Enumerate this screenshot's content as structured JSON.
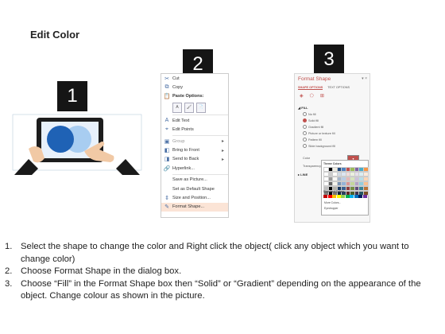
{
  "title": "Edit Color",
  "badges": [
    "1",
    "2",
    "3"
  ],
  "context_menu": {
    "items": [
      {
        "icon": "cut-icon",
        "glyph": "✂",
        "label": "Cut",
        "style": "normal"
      },
      {
        "icon": "copy-icon",
        "glyph": "⧉",
        "label": "Copy",
        "style": "normal"
      },
      {
        "icon": "paste-icon",
        "glyph": "📋",
        "label": "Paste Options:",
        "style": "bold"
      },
      {
        "icon": "edit-text-icon",
        "glyph": "A",
        "label": "Edit Text",
        "style": "normal"
      },
      {
        "icon": "edit-points-icon",
        "glyph": "⌖",
        "label": "Edit Points",
        "style": "normal"
      },
      {
        "icon": "group-icon",
        "glyph": "▣",
        "label": "Group",
        "style": "dim",
        "submenu": true
      },
      {
        "icon": "bring-front-icon",
        "glyph": "◧",
        "label": "Bring to Front",
        "style": "normal",
        "submenu": true
      },
      {
        "icon": "send-back-icon",
        "glyph": "◨",
        "label": "Send to Back",
        "style": "normal",
        "submenu": true
      },
      {
        "icon": "hyperlink-icon",
        "glyph": "🔗",
        "label": "Hyperlink...",
        "style": "normal"
      },
      {
        "icon": "save-picture-icon",
        "glyph": "",
        "label": "Save as Picture...",
        "style": "normal"
      },
      {
        "icon": "default-shape-icon",
        "glyph": "",
        "label": "Set as Default Shape",
        "style": "normal"
      },
      {
        "icon": "size-position-icon",
        "glyph": "⇕",
        "label": "Size and Position...",
        "style": "normal"
      },
      {
        "icon": "format-shape-icon",
        "glyph": "✎",
        "label": "Format Shape...",
        "style": "normal",
        "highlight": true
      }
    ]
  },
  "format_pane": {
    "title": "Format Shape",
    "close": "▾ ×",
    "tabs": [
      "SHAPE OPTIONS",
      "TEXT OPTIONS"
    ],
    "fill_header": "◢ FILL",
    "fill_options": [
      "No fill",
      "Solid fill",
      "Gradient fill",
      "Picture or texture fill",
      "Pattern fill",
      "Slide background fill"
    ],
    "selected_fill": 1,
    "color_label": "Color",
    "transparency_label": "Transparency",
    "line_header": "▸ LINE",
    "palette": {
      "theme_label": "Theme Colors",
      "standard_label": "Standard Colors",
      "more_colors": "More Colors...",
      "eyedropper": "Eyedropper",
      "theme_colors": [
        "#ffffff",
        "#000000",
        "#eeece1",
        "#1f497d",
        "#4f81bd",
        "#c0504d",
        "#9bbb59",
        "#8064a2",
        "#4bacc6",
        "#f79646"
      ],
      "standard_colors": [
        "#c00000",
        "#ff0000",
        "#ffc000",
        "#ffff00",
        "#92d050",
        "#00b050",
        "#00b0f0",
        "#0070c0",
        "#002060",
        "#7030a0"
      ]
    }
  },
  "instructions": [
    {
      "num": "1.",
      "text": "Select the shape to change the color and Right click the object( click any object which you want to change color)"
    },
    {
      "num": "2.",
      "text": "Choose Format Shape in the dialog box."
    },
    {
      "num": "3.",
      "text": "Choose “Fill” in the Format Shape box then “Solid” or “Gradient” depending on the appearance of the object. Change colour as shown in the picture."
    }
  ]
}
